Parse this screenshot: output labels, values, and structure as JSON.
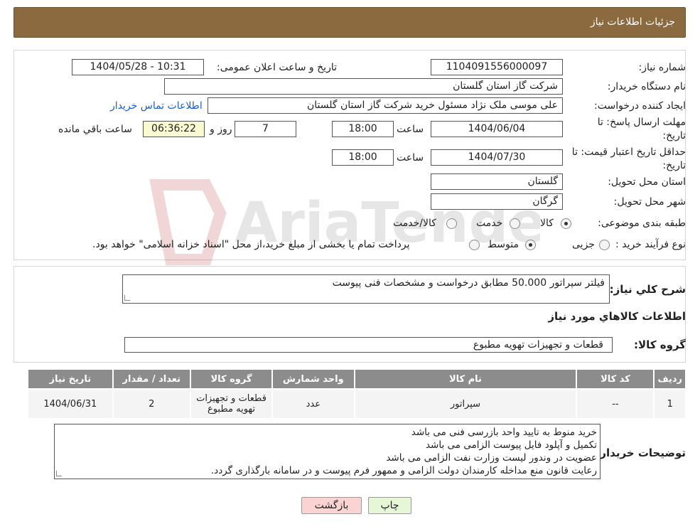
{
  "header": {
    "title": "جزئیات اطلاعات نیاز"
  },
  "fields": {
    "need_number_label": "شماره نیاز:",
    "need_number": "1104091556000097",
    "announce_label": "تاریخ و ساعت اعلان عمومی:",
    "announce_value": "1404/05/28 - 10:31",
    "buyer_org_label": "نام دستگاه خریدار:",
    "buyer_org": "شرکت گاز استان گلستان",
    "requester_label": "ایجاد کننده درخواست:",
    "requester": "علی موسی ملک نژاد مسئول خرید شرکت گاز استان گلستان",
    "contact_link": "اطلاعات تماس خریدار",
    "deadline_label_1": "مهلت ارسال پاسخ: تا",
    "deadline_label_2": "تاریخ:",
    "deadline_date": "1404/06/04",
    "time_label": "ساعت",
    "deadline_time": "18:00",
    "days_value": "7",
    "days_label": "روز و",
    "remaining_time": "06:36:22",
    "remaining_label": "ساعت باقي مانده",
    "validity_label_1": "حداقل تاریخ اعتبار قیمت: تا",
    "validity_label_2": "تاریخ:",
    "validity_date": "1404/07/30",
    "validity_time": "18:00",
    "province_label": "استان محل تحویل:",
    "province": "گلستان",
    "city_label": "شهر محل تحویل:",
    "city": "گرگان",
    "category_label": "طبقه بندی موضوعی:",
    "category_options": [
      "کالا",
      "خدمت",
      "کالا/خدمت"
    ],
    "process_label": "نوع فرآیند خرید :",
    "process_options": [
      "جزیی",
      "متوسط"
    ],
    "process_note": "پرداخت تمام یا بخشی از مبلغ خرید،از محل \"اسناد خزانه اسلامی\" خواهد بود."
  },
  "description": {
    "label": "شرح کلي نياز:",
    "value": "فیلتر سپراتور 50.000 مطابق درخواست و مشخصات فنی پیوست"
  },
  "goods": {
    "section_title": "اطلاعات کالاهاي مورد نياز",
    "group_label": "گروه کالا:",
    "group_value": "قطعات و تجهیزات تهویه مطبوع",
    "columns": [
      "رديف",
      "کد کالا",
      "نام کالا",
      "واحد شمارش",
      "گروه کالا",
      "تعداد / مقدار",
      "تاريخ نياز"
    ],
    "rows": [
      [
        "1",
        "--",
        "سپراتور",
        "عدد",
        "قطعات و تجهیزات تهویه مطبوع",
        "2",
        "1404/06/31"
      ]
    ]
  },
  "buyer_notes": {
    "label": "توضيحات خريدار:",
    "lines": [
      "خرید منوط به تایید واحد بازرسی فنی می باشد",
      "تکمیل و آپلود فایل پیوست الزامی می باشد",
      "عضویت در وندور لیست وزارت نفت  الزامی می باشد",
      "رعایت قانون منع مداخله کارمندان دولت الزامی و ممهور فرم پیوست و در سامانه بارگذاری گردد."
    ]
  },
  "buttons": {
    "print": "چاپ",
    "back": "بازگشت"
  },
  "watermark": "AriaTender.neT",
  "colors": {
    "header": "#8c6a3f",
    "link": "#1a5fd0",
    "timer_bg": "#fafad2",
    "back_btn": "#fbd3d3",
    "print_btn": "#e6f7d8"
  }
}
